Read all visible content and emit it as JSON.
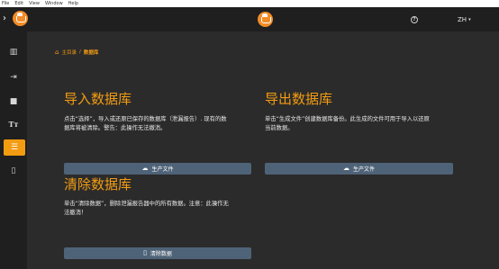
{
  "os_menu": [
    "File",
    "Edit",
    "View",
    "Window",
    "Help"
  ],
  "topbar": {
    "expand_icon": "chevron-right",
    "help_icon": "help-circle",
    "language": "ZH",
    "language_caret": "▾"
  },
  "sidebar": {
    "items": [
      {
        "name": "building",
        "glyph": "▥"
      },
      {
        "name": "import",
        "glyph": "⇥"
      },
      {
        "name": "briefcase",
        "glyph": "■"
      },
      {
        "name": "text",
        "glyph": "Tт"
      },
      {
        "name": "list",
        "glyph": "☰",
        "active": true
      },
      {
        "name": "trash",
        "glyph": "▯"
      }
    ]
  },
  "breadcrumb": {
    "home": "主目录",
    "separator": "/",
    "current": "数据库"
  },
  "import_section": {
    "title": "导入数据库",
    "desc_line1": "点击“选择”，导入或还原已保存的数据库（泄漏报告）. 现有的数",
    "desc_line2": "据库将被清除。警告：此操作无法撤消。",
    "button": "生产文件"
  },
  "export_section": {
    "title": "导出数据库",
    "desc_line1": "单击“生成文件”创建数据库备份。此生成的文件可用于导入以还原",
    "desc_line2": "当前数据。",
    "button": "生产文件"
  },
  "clear_section": {
    "title": "清除数据库",
    "desc_line1": "单击“清除数据”，删除泄漏报告器中的所有数据。注意：此操作无",
    "desc_line2": "法撤消！",
    "button": "清除数据"
  },
  "colors": {
    "accent": "#f39c12",
    "button_bg": "#4f6378",
    "bg": "#2b2b2b",
    "bar_bg": "#1f1f1f"
  }
}
